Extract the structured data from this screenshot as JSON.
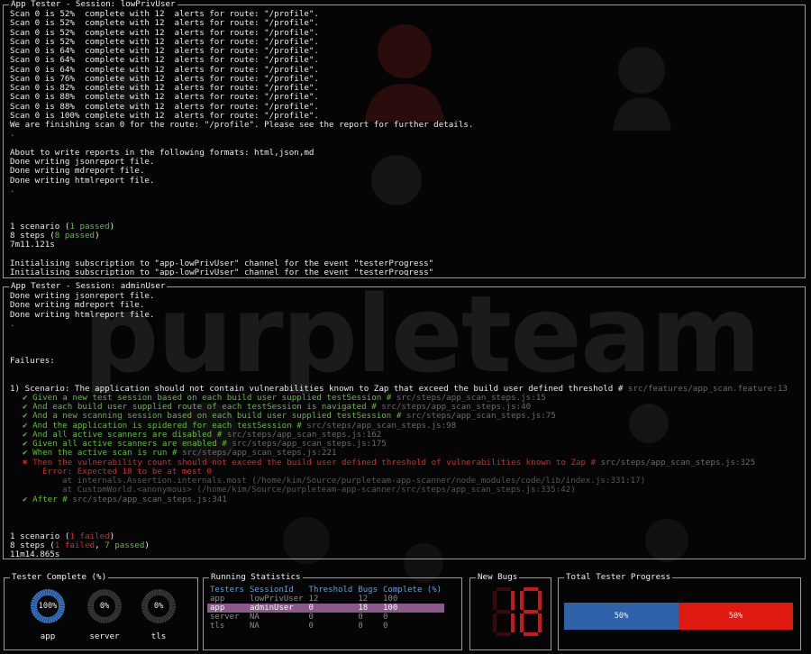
{
  "colors": {
    "background": "#050505",
    "text": "#eaeaea",
    "green": "#5fbf2a",
    "red": "#e62020",
    "grey": "#6a6a6a",
    "panel_border": "#9a9a9a",
    "table_header": "#6aa0d6",
    "selected_row": "#8a5a8c",
    "progress_blue": "#2f62a8",
    "progress_red": "#e01a10",
    "bugs_red": "#c8181c"
  },
  "watermark": {
    "text": "purpleteam"
  },
  "panels": {
    "low_priv": {
      "title": "App Tester - Session: lowPrivUser",
      "lines": [
        {
          "text": "Scan 0 is 52%  complete with 12  alerts for route: \"/profile\".",
          "color": "default"
        },
        {
          "text": "Scan 0 is 52%  complete with 12  alerts for route: \"/profile\".",
          "color": "default"
        },
        {
          "text": "Scan 0 is 52%  complete with 12  alerts for route: \"/profile\".",
          "color": "default"
        },
        {
          "text": "Scan 0 is 52%  complete with 12  alerts for route: \"/profile\".",
          "color": "default"
        },
        {
          "text": "Scan 0 is 64%  complete with 12  alerts for route: \"/profile\".",
          "color": "default"
        },
        {
          "text": "Scan 0 is 64%  complete with 12  alerts for route: \"/profile\".",
          "color": "default"
        },
        {
          "text": "Scan 0 is 64%  complete with 12  alerts for route: \"/profile\".",
          "color": "default"
        },
        {
          "text": "Scan 0 is 76%  complete with 12  alerts for route: \"/profile\".",
          "color": "default"
        },
        {
          "text": "Scan 0 is 82%  complete with 12  alerts for route: \"/profile\".",
          "color": "default"
        },
        {
          "text": "Scan 0 is 88%  complete with 12  alerts for route: \"/profile\".",
          "color": "default"
        },
        {
          "text": "Scan 0 is 88%  complete with 12  alerts for route: \"/profile\".",
          "color": "default"
        },
        {
          "text": "Scan 0 is 100% complete with 12  alerts for route: \"/profile\".",
          "color": "default"
        },
        {
          "text": "We are finishing scan 0 for the route: \"/profile\". Please see the report for further details.",
          "color": "default"
        },
        {
          "text": ".",
          "color": "green"
        },
        {
          "text": "",
          "color": "default"
        },
        {
          "text": "About to write reports in the following formats: html,json,md",
          "color": "default"
        },
        {
          "text": "Done writing jsonreport file.",
          "color": "default"
        },
        {
          "text": "Done writing mdreport file.",
          "color": "default"
        },
        {
          "text": "Done writing htmlreport file.",
          "color": "default"
        },
        {
          "text": ".",
          "color": "green"
        },
        {
          "text": "",
          "color": "default"
        },
        {
          "text": "",
          "color": "default"
        },
        {
          "text": "",
          "color": "default"
        },
        {
          "parts": [
            {
              "text": "1 scenario (",
              "color": "default"
            },
            {
              "text": "1 passed",
              "color": "green"
            },
            {
              "text": ")",
              "color": "default"
            }
          ]
        },
        {
          "parts": [
            {
              "text": "8 steps (",
              "color": "default"
            },
            {
              "text": "8 passed",
              "color": "green"
            },
            {
              "text": ")",
              "color": "default"
            }
          ]
        },
        {
          "text": "7m11.121s",
          "color": "default"
        },
        {
          "text": "",
          "color": "default"
        },
        {
          "text": "Initialising subscription to \"app-lowPrivUser\" channel for the event \"testerProgress\"",
          "color": "default"
        },
        {
          "text": "Initialising subscription to \"app-lowPrivUser\" channel for the event \"testerProgress\"",
          "color": "default"
        }
      ]
    },
    "admin": {
      "title": "App Tester - Session: adminUser",
      "lines": [
        {
          "text": "Done writing jsonreport file.",
          "color": "default"
        },
        {
          "text": "Done writing mdreport file.",
          "color": "default"
        },
        {
          "text": "Done writing htmlreport file.",
          "color": "default"
        },
        {
          "text": ".",
          "color": "green"
        },
        {
          "text": "",
          "color": "default"
        },
        {
          "text": "",
          "color": "default"
        },
        {
          "text": "",
          "color": "default"
        },
        {
          "text": "Failures:",
          "color": "default"
        },
        {
          "text": "",
          "color": "default"
        },
        {
          "text": "",
          "color": "default"
        },
        {
          "parts": [
            {
              "text": "1) Scenario: The application should not contain vulnerabilities known to Zap that exceed the build user defined threshold # ",
              "color": "default"
            },
            {
              "text": "src/features/app_scan.feature:13",
              "color": "grey"
            }
          ]
        },
        {
          "indent": 1,
          "parts": [
            {
              "text": "✔ Given a new test session based on each build user supplied testSession # ",
              "color": "green"
            },
            {
              "text": "src/steps/app_scan_steps.js:15",
              "color": "grey"
            }
          ]
        },
        {
          "indent": 1,
          "parts": [
            {
              "text": "✔ And each build user supplied route of each testSession is navigated # ",
              "color": "green"
            },
            {
              "text": "src/steps/app_scan_steps.js:40",
              "color": "grey"
            }
          ]
        },
        {
          "indent": 1,
          "parts": [
            {
              "text": "✔ And a new scanning session based on each build user supplied testSession # ",
              "color": "green"
            },
            {
              "text": "src/steps/app_scan_steps.js:75",
              "color": "grey"
            }
          ]
        },
        {
          "indent": 1,
          "parts": [
            {
              "text": "✔ And the application is spidered for each testSession # ",
              "color": "green"
            },
            {
              "text": "src/steps/app_scan_steps.js:98",
              "color": "grey"
            }
          ]
        },
        {
          "indent": 1,
          "parts": [
            {
              "text": "✔ And all active scanners are disabled # ",
              "color": "green"
            },
            {
              "text": "src/steps/app_scan_steps.js:162",
              "color": "grey"
            }
          ]
        },
        {
          "indent": 1,
          "parts": [
            {
              "text": "✔ Given all active scanners are enabled # ",
              "color": "green"
            },
            {
              "text": "src/steps/app_scan_steps.js:175",
              "color": "grey"
            }
          ]
        },
        {
          "indent": 1,
          "parts": [
            {
              "text": "✔ When the active scan is run # ",
              "color": "green"
            },
            {
              "text": "src/steps/app_scan_steps.js:221",
              "color": "grey"
            }
          ]
        },
        {
          "indent": 1,
          "parts": [
            {
              "text": "✖ Then the vulnerability count should not exceed the build user defined threshold of vulnerabilities known to Zap # ",
              "color": "red"
            },
            {
              "text": "src/steps/app_scan_steps.js:325",
              "color": "grey"
            }
          ]
        },
        {
          "indent": 2,
          "parts": [
            {
              "text": "Error: Expected 18 to be at most 0",
              "color": "red"
            }
          ]
        },
        {
          "indent": 3,
          "parts": [
            {
              "text": "at internals.Assertion.internals.most (/home/kim/Source/purpleteam-app-scanner/node_modules/code/lib/index.js:331:17)",
              "color": "dgrey"
            }
          ]
        },
        {
          "indent": 3,
          "parts": [
            {
              "text": "at CustomWorld.<anonymous> (/home/kim/Source/purpleteam-app-scanner/src/steps/app_scan_steps.js:335:42)",
              "color": "dgrey"
            }
          ]
        },
        {
          "indent": 1,
          "parts": [
            {
              "text": "✔ After # ",
              "color": "green"
            },
            {
              "text": "src/steps/app_scan_steps.js:341",
              "color": "grey"
            }
          ]
        },
        {
          "text": "",
          "color": "default"
        },
        {
          "text": "",
          "color": "default"
        },
        {
          "text": "",
          "color": "default"
        },
        {
          "parts": [
            {
              "text": "1 scenario (",
              "color": "default"
            },
            {
              "text": "1 failed",
              "color": "red"
            },
            {
              "text": ")",
              "color": "default"
            }
          ]
        },
        {
          "parts": [
            {
              "text": "8 steps (",
              "color": "default"
            },
            {
              "text": "1 failed",
              "color": "red"
            },
            {
              "text": ", ",
              "color": "default"
            },
            {
              "text": "7 passed",
              "color": "green"
            },
            {
              "text": ")",
              "color": "default"
            }
          ]
        },
        {
          "text": "11m14.865s",
          "color": "default"
        }
      ]
    }
  },
  "tester_complete": {
    "title": "Tester Complete (%)",
    "items": [
      {
        "label": "app",
        "value": "100%",
        "percent": 100
      },
      {
        "label": "server",
        "value": "0%",
        "percent": 0
      },
      {
        "label": "tls",
        "value": "0%",
        "percent": 0
      }
    ]
  },
  "running_statistics": {
    "title": "Running Statistics",
    "headers": [
      "Testers",
      "SessionId",
      "Threshold",
      "Bugs",
      "Complete (%)"
    ],
    "rows": [
      {
        "cells": [
          "app",
          "lowPrivUser",
          "12",
          "12",
          "100"
        ],
        "selected": false
      },
      {
        "cells": [
          "app",
          "adminUser",
          "0",
          "18",
          "100"
        ],
        "selected": true
      },
      {
        "cells": [
          "server",
          "NA",
          "0",
          "0",
          "0"
        ],
        "selected": false
      },
      {
        "cells": [
          "tls",
          "NA",
          "0",
          "0",
          "0"
        ],
        "selected": false
      }
    ]
  },
  "new_bugs": {
    "title": "New Bugs",
    "value": "18"
  },
  "total_progress": {
    "title": "Total Tester Progress",
    "segments": [
      {
        "label": "50%",
        "fraction": 0.5,
        "color": "#2f62a8"
      },
      {
        "label": "50%",
        "fraction": 0.5,
        "color": "#e01a10"
      }
    ]
  }
}
